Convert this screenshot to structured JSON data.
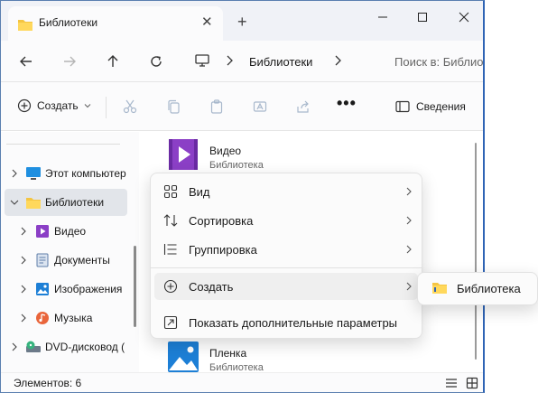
{
  "window": {
    "tab_title": "Библиотеки",
    "accent": "#2f64b5"
  },
  "address": {
    "crumb": "Библиотеки",
    "search_placeholder": "Поиск в: Библиотеки"
  },
  "command_bar": {
    "create_label": "Создать",
    "details_label": "Сведения",
    "more_label": "•••"
  },
  "sidebar": {
    "items": [
      {
        "label": "Этот компьютер",
        "icon": "monitor-icon"
      },
      {
        "label": "Библиотеки",
        "icon": "folder-icon",
        "selected": true
      },
      {
        "label": "Видео",
        "icon": "video-icon"
      },
      {
        "label": "Документы",
        "icon": "documents-icon"
      },
      {
        "label": "Изображения",
        "icon": "pictures-icon"
      },
      {
        "label": "Музыка",
        "icon": "music-icon"
      },
      {
        "label": "DVD-дисковод (",
        "icon": "dvd-icon"
      }
    ]
  },
  "content": {
    "items": [
      {
        "name": "Видео",
        "subtitle": "Библиотека",
        "icon": "video-icon"
      },
      {
        "name": "Пленка",
        "subtitle": "Библиотека",
        "icon": "pictures-icon"
      }
    ]
  },
  "context_menu": {
    "items": [
      {
        "label": "Вид",
        "icon": "view-grid-icon",
        "has_submenu": true
      },
      {
        "label": "Сортировка",
        "icon": "sort-icon",
        "has_submenu": true
      },
      {
        "label": "Группировка",
        "icon": "group-icon",
        "has_submenu": true
      },
      {
        "label": "Создать",
        "icon": "new-icon",
        "has_submenu": true
      },
      {
        "label": "Показать дополнительные параметры",
        "icon": "more-options-icon",
        "has_submenu": false
      }
    ],
    "submenu": {
      "label": "Библиотека",
      "icon": "library-icon"
    }
  },
  "status": {
    "count_text": "Элементов: 6"
  }
}
